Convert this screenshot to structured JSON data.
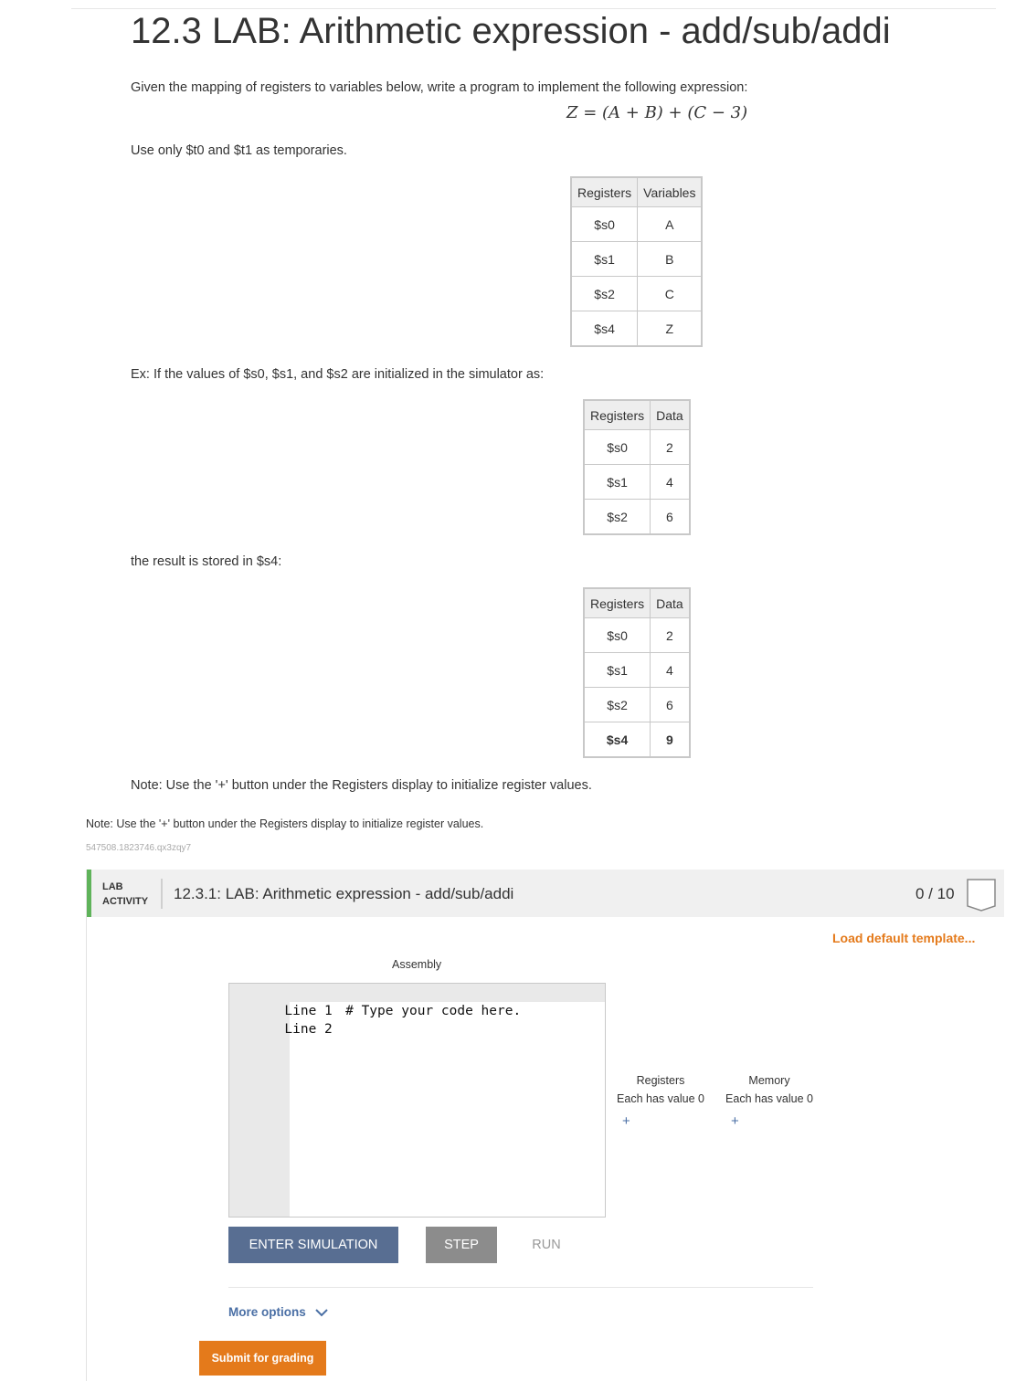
{
  "page": {
    "title": "12.3 LAB: Arithmetic expression - add/sub/addi",
    "intro": "Given the mapping of registers to variables below, write a program to implement the following expression:",
    "expression": "Z = (A + B) + (C − 3)",
    "temporaries": "Use only $t0 and $t1 as temporaries.",
    "example_intro": "Ex: If the values of $s0, $s1, and $s2 are initialized in the simulator as:",
    "result_intro": "the result is stored in $s4:",
    "note_inner": "Note: Use the '+' button under the Registers display to initialize register values.",
    "note_outer": "Note: Use the '+' button under the Registers display to initialize register values.",
    "activity_code": "547508.1823746.qx3zqy7"
  },
  "mapping_table": {
    "headers": [
      "Registers",
      "Variables"
    ],
    "rows": [
      [
        "$s0",
        "A"
      ],
      [
        "$s1",
        "B"
      ],
      [
        "$s2",
        "C"
      ],
      [
        "$s4",
        "Z"
      ]
    ]
  },
  "init_table": {
    "headers": [
      "Registers",
      "Data"
    ],
    "rows": [
      [
        "$s0",
        "2"
      ],
      [
        "$s1",
        "4"
      ],
      [
        "$s2",
        "6"
      ]
    ]
  },
  "result_table": {
    "headers": [
      "Registers",
      "Data"
    ],
    "rows": [
      [
        "$s0",
        "2"
      ],
      [
        "$s1",
        "4"
      ],
      [
        "$s2",
        "6"
      ],
      [
        "$s4",
        "9"
      ]
    ]
  },
  "lab": {
    "tag_line1": "LAB",
    "tag_line2": "ACTIVITY",
    "title": "12.3.1: LAB: Arithmetic expression - add/sub/addi",
    "score": "0 / 10",
    "load_template": "Load default template...",
    "assembly_label": "Assembly",
    "code_lines": [
      {
        "label": "Line 1",
        "text": " # Type your code here."
      },
      {
        "label": "Line 2",
        "text": ""
      }
    ],
    "registers_title": "Registers",
    "registers_sub": "Each has value 0",
    "memory_title": "Memory",
    "memory_sub": "Each has value 0",
    "add_symbol": "+",
    "enter_sim": "ENTER SIMULATION",
    "step": "STEP",
    "run": "RUN",
    "more_options": "More options",
    "submit": "Submit for grading"
  },
  "colors": {
    "accent_green": "#5fb35a",
    "accent_orange": "#e47a1b",
    "link_blue": "#4a6fa5",
    "button_slate": "#586e92",
    "button_gray": "#8c8c8c"
  },
  "icons": {
    "score_badge": "badge-icon",
    "more_options": "chevron-down-icon"
  }
}
